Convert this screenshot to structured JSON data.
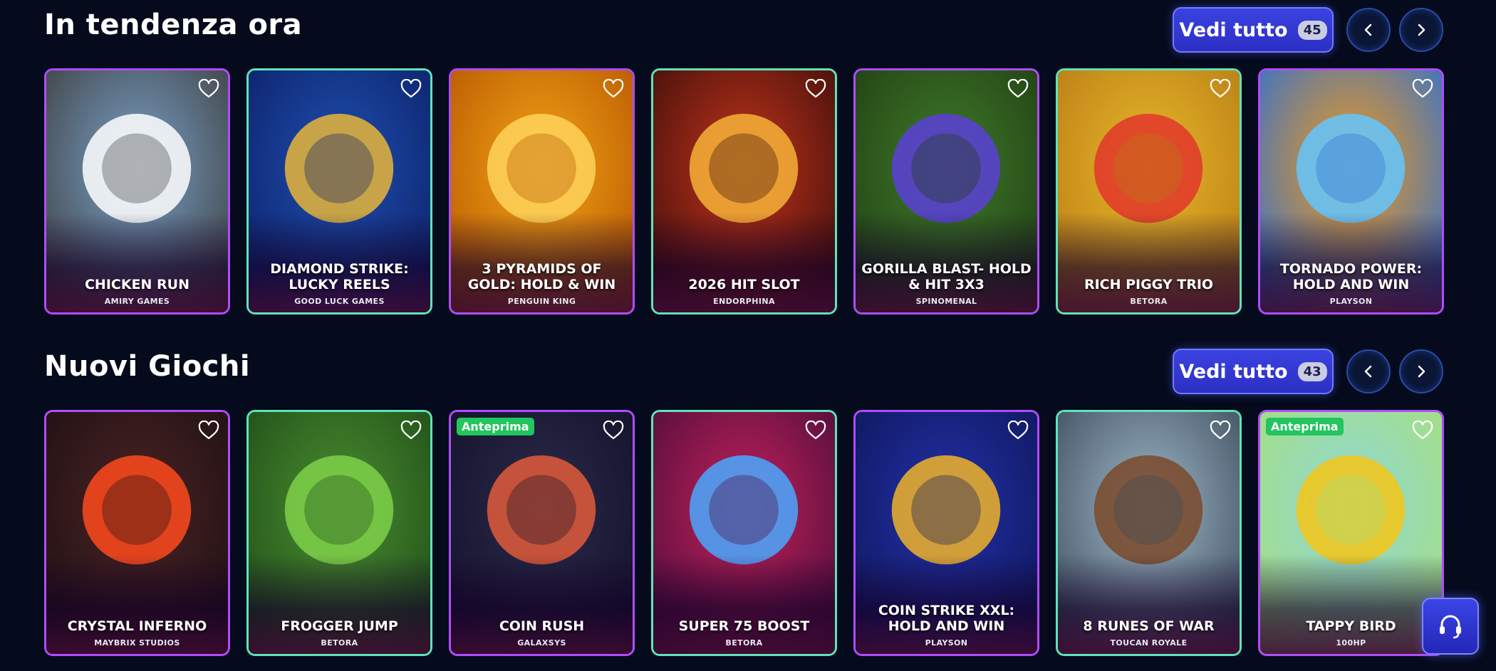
{
  "trending": {
    "title": "In tendenza ora",
    "see_all_label": "Vedi tutto",
    "see_all_count": "45",
    "games": [
      {
        "title": "CHICKEN RUN",
        "provider": "AMIRY GAMES",
        "bg1": "#7aa1c7",
        "bg2": "#3b3b3b",
        "accent": "#ffffff"
      },
      {
        "title": "DIAMOND STRIKE: LUCKY REELS",
        "provider": "GOOD LUCK GAMES",
        "bg1": "#1e4fb0",
        "bg2": "#0c1f66",
        "accent": "#e8b53a"
      },
      {
        "title": "3 PYRAMIDS OF GOLD: HOLD & WIN",
        "provider": "PENGUIN KING",
        "bg1": "#f2a316",
        "bg2": "#b55400",
        "accent": "#ffd35a"
      },
      {
        "title": "2026 HIT SLOT",
        "provider": "ENDORPHINA",
        "bg1": "#c2331b",
        "bg2": "#3a0d0a",
        "accent": "#f7b237"
      },
      {
        "title": "GORILLA BLAST- HOLD & HIT 3X3",
        "provider": "SPINOMENAL",
        "bg1": "#3f7a2a",
        "bg2": "#1f3d12",
        "accent": "#5a3fd8"
      },
      {
        "title": "RICH PIGGY TRIO",
        "provider": "BETORA",
        "bg1": "#e8b82a",
        "bg2": "#b67a14",
        "accent": "#e2372a"
      },
      {
        "title": "TORNADO POWER: HOLD AND WIN",
        "provider": "PLAYSON",
        "bg1": "#f29a1a",
        "bg2": "#2a6fd6",
        "accent": "#63c6ff"
      }
    ]
  },
  "new_games": {
    "title": "Nuovi Giochi",
    "see_all_label": "Vedi tutto",
    "see_all_count": "43",
    "games": [
      {
        "title": "CRYSTAL INFERNO",
        "provider": "MAYBRIX STUDIOS",
        "bg1": "#4a2424",
        "bg2": "#1d0f12",
        "accent": "#ff4a1c",
        "badge": ""
      },
      {
        "title": "FROGGER JUMP",
        "provider": "BETORA",
        "bg1": "#4b8f2f",
        "bg2": "#1d4a18",
        "accent": "#7fd14a",
        "badge": ""
      },
      {
        "title": "COIN RUSH",
        "provider": "GALAXSYS",
        "bg1": "#2b2a4a",
        "bg2": "#121028",
        "accent": "#e25a3a",
        "badge": "Anteprima"
      },
      {
        "title": "SUPER 75 BOOST",
        "provider": "BETORA",
        "bg1": "#c2215a",
        "bg2": "#4a0c3a",
        "accent": "#4aa8ff",
        "badge": ""
      },
      {
        "title": "COIN STRIKE XXL: HOLD AND WIN",
        "provider": "PLAYSON",
        "bg1": "#2230a8",
        "bg2": "#0e1658",
        "accent": "#f0b42a",
        "badge": ""
      },
      {
        "title": "8 RUNES OF WAR",
        "provider": "TOUCAN ROYALE",
        "bg1": "#9fb7c8",
        "bg2": "#3a4a5a",
        "accent": "#7a4a2a",
        "badge": ""
      },
      {
        "title": "TAPPY BIRD",
        "provider": "100HP",
        "bg1": "#8fd8d8",
        "bg2": "#a7e07a",
        "accent": "#f5c518",
        "badge": "Anteprima"
      }
    ]
  },
  "icons": {
    "prev": "chevron-left-icon",
    "next": "chevron-right-icon",
    "favorite": "heart-icon",
    "support": "headset-icon"
  }
}
